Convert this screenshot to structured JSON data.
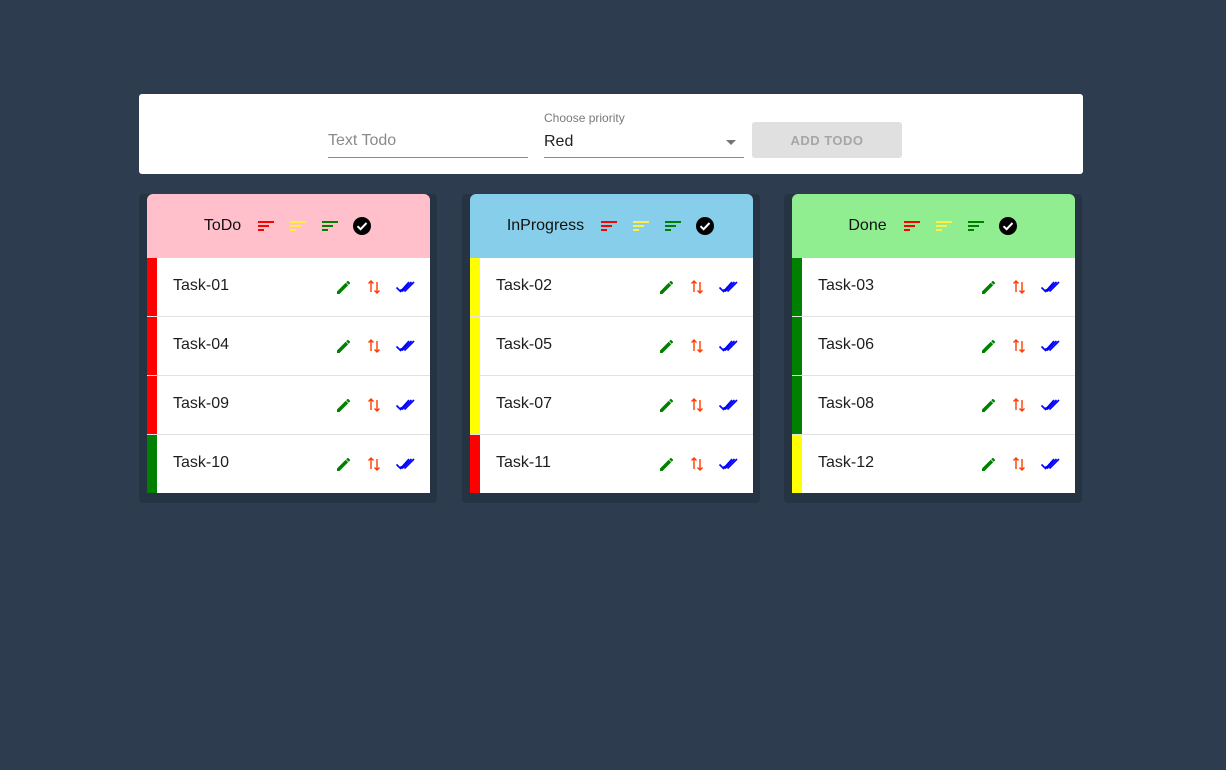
{
  "form": {
    "text_placeholder": "Text Todo",
    "priority_label": "Choose priority",
    "priority_value": "Red",
    "add_button": "ADD TODO"
  },
  "colors": {
    "red": "#ff0000",
    "yellow": "#ffff00",
    "green": "#008000"
  },
  "icons": {
    "edit": "pencil-icon",
    "move": "swap-vertical-icon",
    "done": "double-check-icon",
    "sort": "sort-icon",
    "complete": "check-circle-icon"
  },
  "columns": [
    {
      "title": "ToDo",
      "color": "#ffc0cb",
      "tasks": [
        {
          "name": "Task-01",
          "priority": "red"
        },
        {
          "name": "Task-04",
          "priority": "red"
        },
        {
          "name": "Task-09",
          "priority": "red"
        },
        {
          "name": "Task-10",
          "priority": "green"
        }
      ]
    },
    {
      "title": "InProgress",
      "color": "#87ceeb",
      "tasks": [
        {
          "name": "Task-02",
          "priority": "yellow"
        },
        {
          "name": "Task-05",
          "priority": "yellow"
        },
        {
          "name": "Task-07",
          "priority": "yellow"
        },
        {
          "name": "Task-11",
          "priority": "red"
        }
      ]
    },
    {
      "title": "Done",
      "color": "#90ee90",
      "tasks": [
        {
          "name": "Task-03",
          "priority": "green"
        },
        {
          "name": "Task-06",
          "priority": "green"
        },
        {
          "name": "Task-08",
          "priority": "green"
        },
        {
          "name": "Task-12",
          "priority": "yellow"
        }
      ]
    }
  ]
}
